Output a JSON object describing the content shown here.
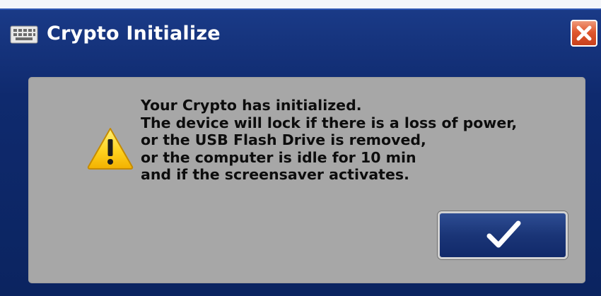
{
  "dialog": {
    "title": "Crypto Initialize",
    "app_icon": "keyboard-icon",
    "close_icon": "close-x-icon",
    "warning_icon": "warning-triangle-icon",
    "message_lines": [
      "Your Crypto has initialized.",
      "The device will lock if there is a loss of power,",
      "or the USB Flash Drive is removed,",
      "or the computer is idle for 10 min",
      "and if the screensaver activates."
    ],
    "ok_button_icon": "checkmark-icon"
  },
  "colors": {
    "title_bar": "#0f2a6e",
    "panel": "#a7a7a7",
    "close_button": "#e0582f",
    "ok_button": "#1a3577",
    "warning": "#ffd21f"
  }
}
